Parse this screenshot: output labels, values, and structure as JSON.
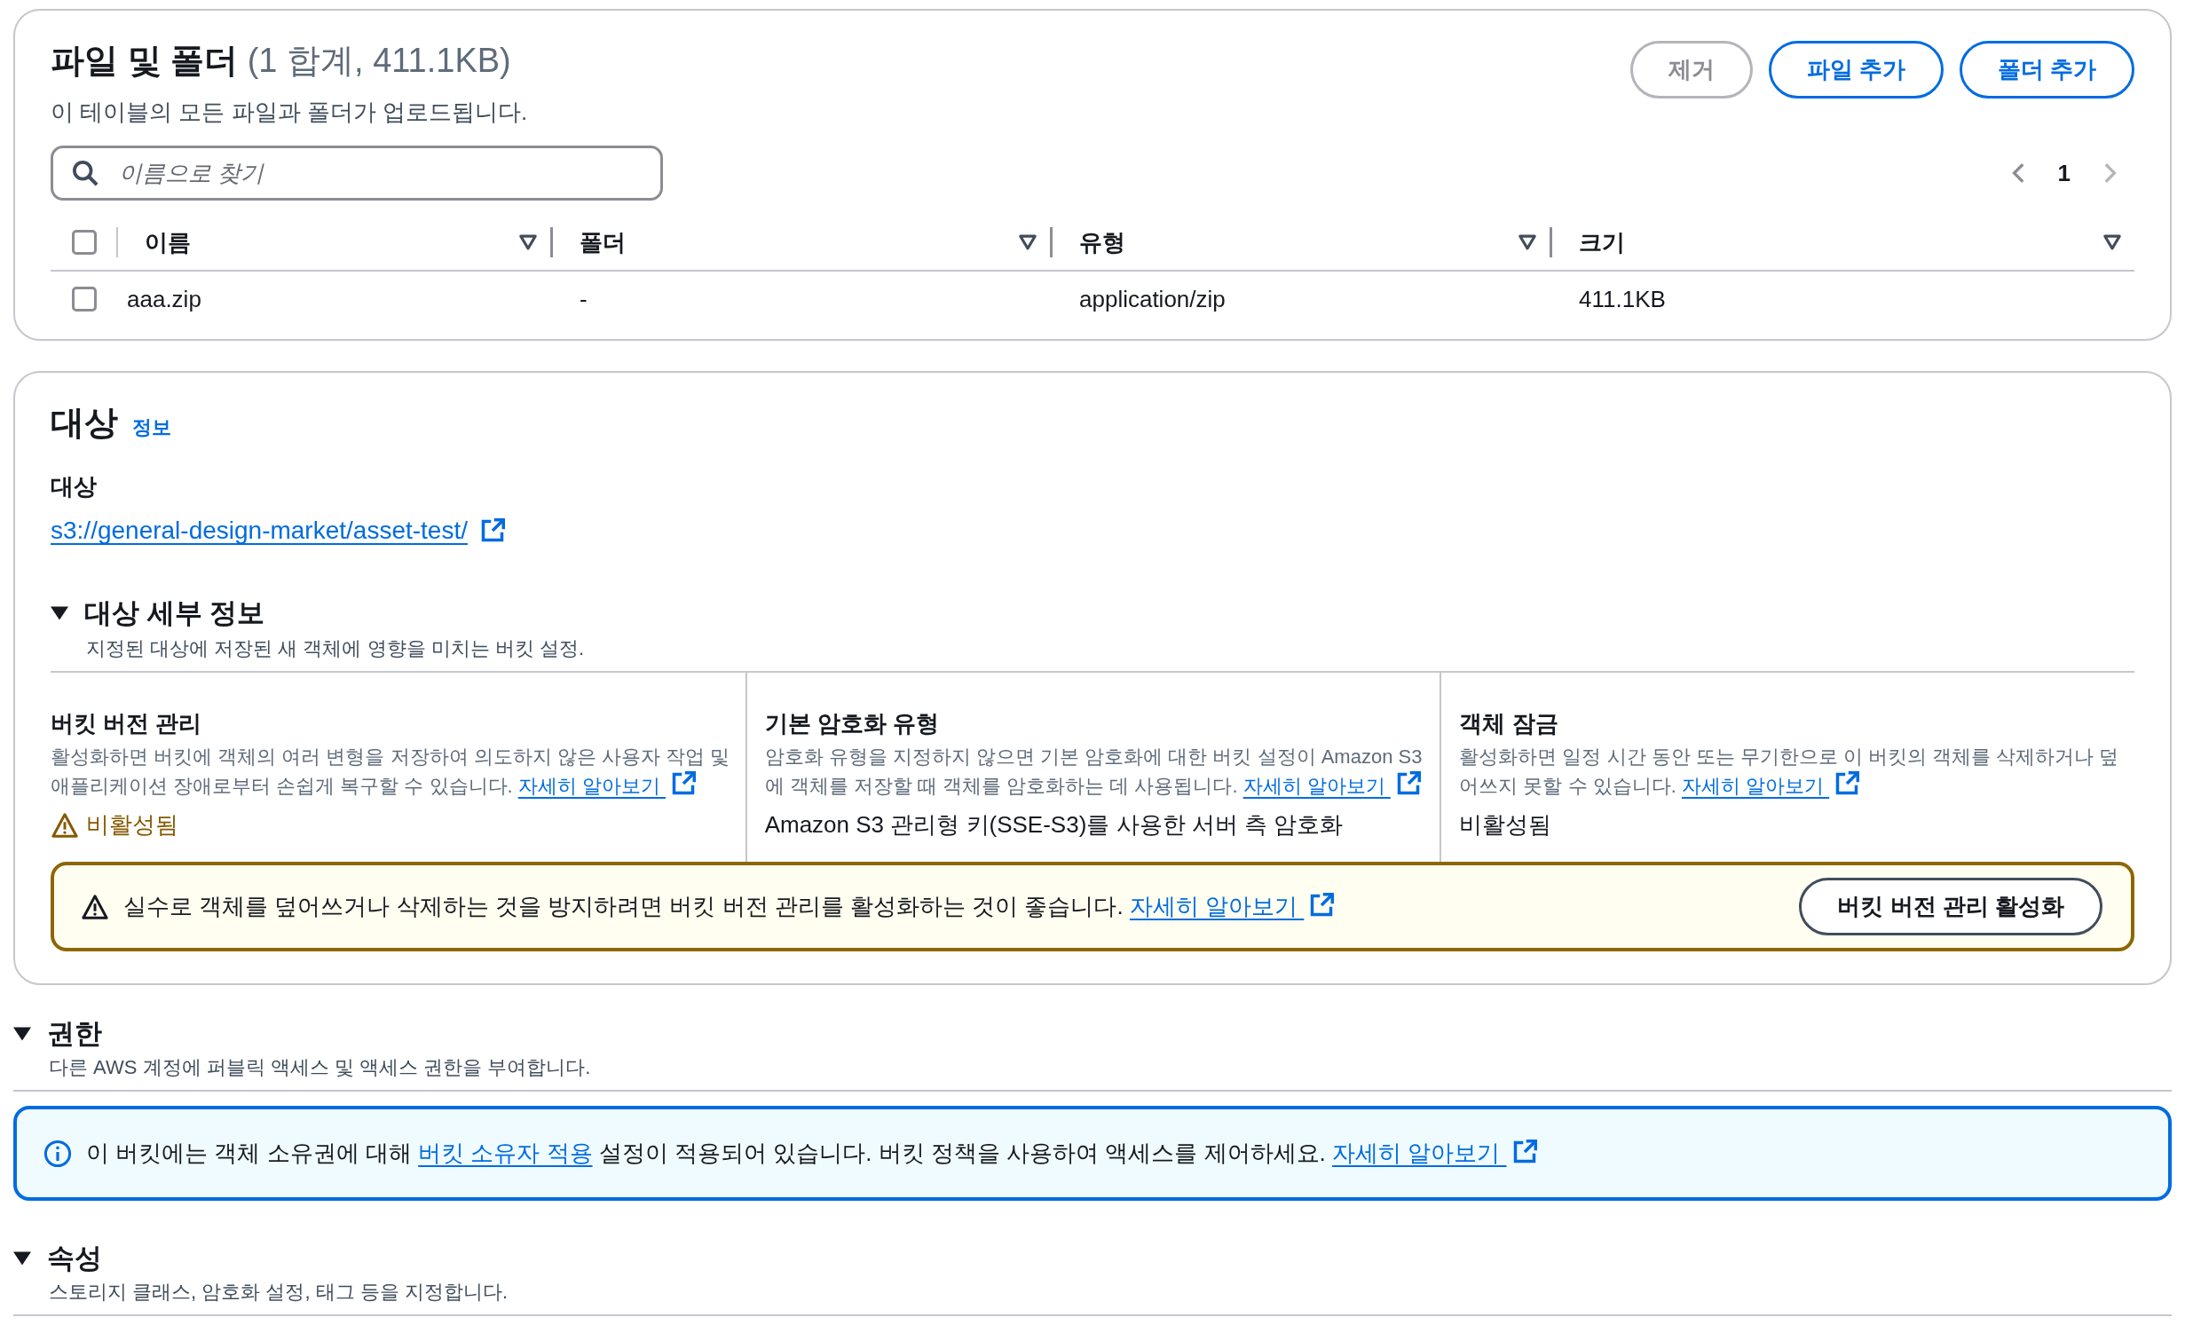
{
  "files": {
    "title": "파일 및 폴더",
    "summary": "(1 합계, 411.1KB)",
    "description": "이 테이블의 모든 파일과 폴더가 업로드됩니다.",
    "buttons": [
      {
        "label": "제거",
        "disabled": true
      },
      {
        "label": "파일 추가",
        "disabled": false
      },
      {
        "label": "폴더 추가",
        "disabled": false
      }
    ],
    "search": {
      "placeholder": "이름으로 찾기"
    },
    "pagination": {
      "page": "1"
    },
    "table": {
      "all_checked": false,
      "columns": [
        "이름",
        "폴더",
        "유형",
        "크기"
      ],
      "rows": [
        {
          "checked": false,
          "cells": [
            "aaa.zip",
            "-",
            "application/zip",
            "411.1KB"
          ]
        }
      ]
    }
  },
  "destination": {
    "title": "대상",
    "info_link": "정보",
    "label": "대상",
    "link": "s3://general-design-market/asset-test/",
    "details": {
      "title": "대상 세부 정보",
      "expanded": true,
      "description": "지정된 대상에 저장된 새 객체에 영향을 미치는 버킷 설정.",
      "columns": [
        {
          "title": "버킷 버전 관리",
          "description": "활성화하면 버킷에 객체의 여러 변형을 저장하여 의도하지 않은 사용자 작업 및 애플리케이션 장애로부터 손쉽게 복구할 수 있습니다.",
          "learn_more": "자세히 알아보기",
          "value": "비활성됨",
          "kind": "warning"
        },
        {
          "title": "기본 암호화 유형",
          "description": "암호화 유형을 지정하지 않으면 기본 암호화에 대한 버킷 설정이 Amazon S3에 객체를 저장할 때 객체를 암호화하는 데 사용됩니다.",
          "learn_more": "자세히 알아보기",
          "value": "Amazon S3 관리형 키(SSE-S3)를 사용한 서버 측 암호화",
          "kind": "plain"
        },
        {
          "title": "객체 잠금",
          "description": "활성화하면 일정 시간 동안 또는 무기한으로 이 버킷의 객체를 삭제하거나 덮어쓰지 못할 수 있습니다.",
          "learn_more": "자세히 알아보기",
          "value": "비활성됨",
          "kind": "plain"
        }
      ],
      "alert": {
        "text": "실수로 객체를 덮어쓰거나 삭제하는 것을 방지하려면 버킷 버전 관리를 활성화하는 것이 좋습니다.",
        "learn_more": "자세히 알아보기",
        "button": "버킷 버전 관리 활성화"
      }
    }
  },
  "permissions": {
    "title": "권한",
    "expanded": true,
    "description": "다른 AWS 계정에 퍼블릭 액세스 및 액세스 권한을 부여합니다.",
    "info": {
      "before": "이 버킷에는 객체 소유권에 대해",
      "link": "버킷 소유자 적용",
      "after": "설정이 적용되어 있습니다. 버킷 정책을 사용하여 액세스를 제어하세요.",
      "learn_more": "자세히 알아보기"
    }
  },
  "properties": {
    "title": "속성",
    "expanded": true,
    "description": "스토리지 클래스, 암호화 설정, 태그 등을 지정합니다."
  }
}
